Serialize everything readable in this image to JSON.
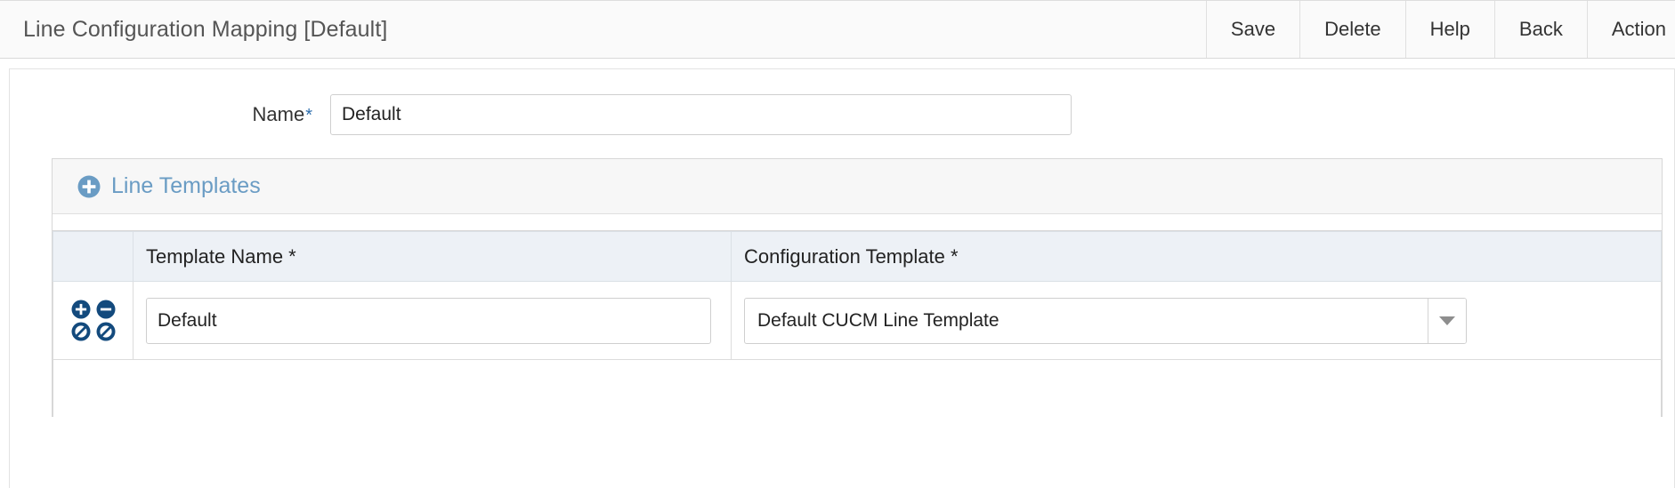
{
  "header": {
    "title": "Line Configuration Mapping [Default]",
    "actions": [
      {
        "label": "Save",
        "name": "save-button"
      },
      {
        "label": "Delete",
        "name": "delete-button"
      },
      {
        "label": "Help",
        "name": "help-button"
      },
      {
        "label": "Back",
        "name": "back-button"
      },
      {
        "label": "Action",
        "name": "action-button"
      }
    ]
  },
  "form": {
    "name_label": "Name",
    "name_required_marker": "*",
    "name_value": "Default",
    "name_placeholder": ""
  },
  "panel": {
    "title": "Line Templates",
    "add_icon": "circle-plus-icon"
  },
  "table": {
    "columns": [
      {
        "key": "actions",
        "label": ""
      },
      {
        "key": "template_name",
        "label": "Template Name *"
      },
      {
        "key": "configuration_template",
        "label": "Configuration Template *"
      }
    ],
    "rows": [
      {
        "template_name": "Default",
        "template_name_placeholder": "",
        "configuration_template": "Default CUCM Line Template",
        "icons": [
          "circle-plus-icon",
          "circle-minus-icon",
          "circle-slash-icon",
          "circle-slash-icon"
        ]
      }
    ]
  },
  "colors": {
    "accent_blue": "#6a9cc4",
    "required_star": "#2f6fad",
    "icon_navy": "#134a7d",
    "header_row": "#edf1f6",
    "titlebar_bg": "#fafafa"
  }
}
